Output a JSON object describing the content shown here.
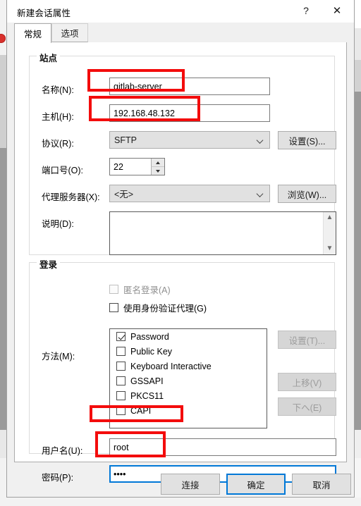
{
  "window": {
    "title": "新建会话属性",
    "help_label": "?",
    "close_label": "✕"
  },
  "tabs": [
    {
      "label": "常规",
      "active": true
    },
    {
      "label": "选项",
      "active": false
    }
  ],
  "site_group": {
    "title": "站点",
    "name_label": "名称(N):",
    "name_value": "gitlab-server",
    "host_label": "主机(H):",
    "host_value": "192.168.48.132",
    "protocol_label": "协议(R):",
    "protocol_value": "SFTP",
    "protocol_settings_button": "设置(S)...",
    "port_label": "端口号(O):",
    "port_value": "22",
    "proxy_label": "代理服务器(X):",
    "proxy_value": "<无>",
    "proxy_browse_button": "浏览(W)...",
    "description_label": "说明(D):",
    "description_value": ""
  },
  "login_group": {
    "title": "登录",
    "anonymous_label": "匿名登录(A)",
    "anonymous_checked": false,
    "anonymous_disabled": true,
    "agent_label": "使用身份验证代理(G)",
    "agent_checked": false,
    "method_label": "方法(M):",
    "methods": [
      {
        "label": "Password",
        "checked": true
      },
      {
        "label": "Public Key",
        "checked": false
      },
      {
        "label": "Keyboard Interactive",
        "checked": false
      },
      {
        "label": "GSSAPI",
        "checked": false
      },
      {
        "label": "PKCS11",
        "checked": false
      },
      {
        "label": "CAPI",
        "checked": false
      }
    ],
    "method_settings_button": "设置(T)...",
    "move_up_button": "上移(V)",
    "move_down_button": "下へ(E)",
    "username_label": "用户名(U):",
    "username_value": "root",
    "password_label": "密码(P):",
    "password_value": "••••"
  },
  "footer": {
    "connect_label": "连接",
    "ok_label": "确定",
    "cancel_label": "取消"
  },
  "annotation_color": "#f30c0c",
  "accent_color": "#0078d7"
}
